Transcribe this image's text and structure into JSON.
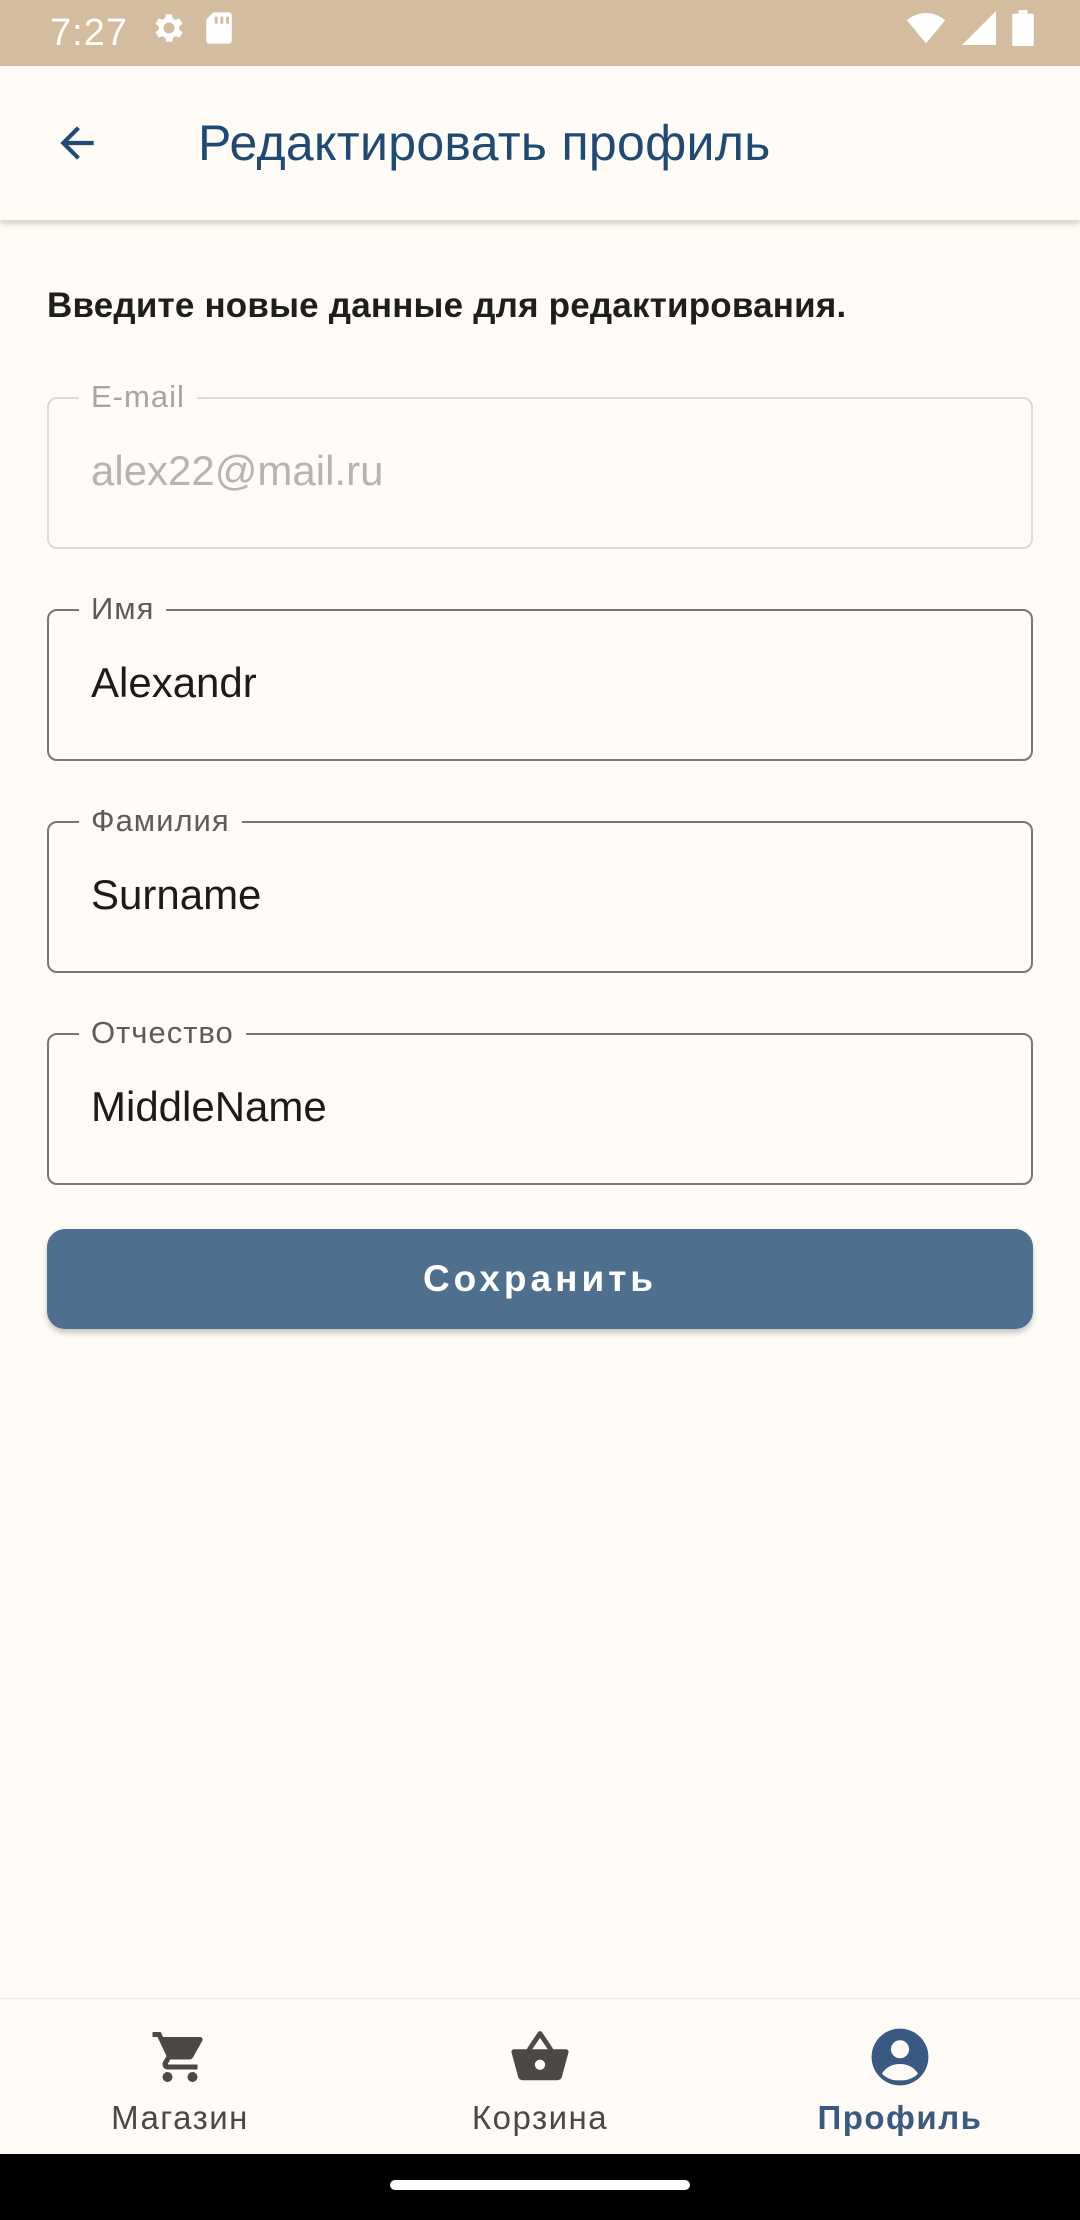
{
  "status_bar": {
    "time": "7:27",
    "icons": [
      "settings-icon",
      "sd-card-icon",
      "wifi-icon",
      "signal-icon",
      "battery-icon"
    ]
  },
  "app_bar": {
    "title": "Редактировать профиль",
    "back_icon": "arrow-back-icon"
  },
  "form": {
    "instruction": "Введите новые данные для редактирования.",
    "email": {
      "label": "E-mail",
      "value": "alex22@mail.ru",
      "enabled": false
    },
    "first_name": {
      "label": "Имя",
      "value": "Alexandr"
    },
    "last_name": {
      "label": "Фамилия",
      "value": "Surname"
    },
    "middle_name": {
      "label": "Отчество",
      "value": "MiddleName"
    },
    "save_label": "Сохранить"
  },
  "bottom_nav": {
    "items": [
      {
        "label": "Магазин",
        "icon": "cart-icon",
        "active": false
      },
      {
        "label": "Корзина",
        "icon": "basket-icon",
        "active": false
      },
      {
        "label": "Профиль",
        "icon": "account-circle-icon",
        "active": true
      }
    ]
  },
  "colors": {
    "status_bar": "#d4bd9e",
    "background": "#fffbf6",
    "title": "#1e4a73",
    "button": "#4f6f8f",
    "nav_active": "#3b5a82"
  }
}
